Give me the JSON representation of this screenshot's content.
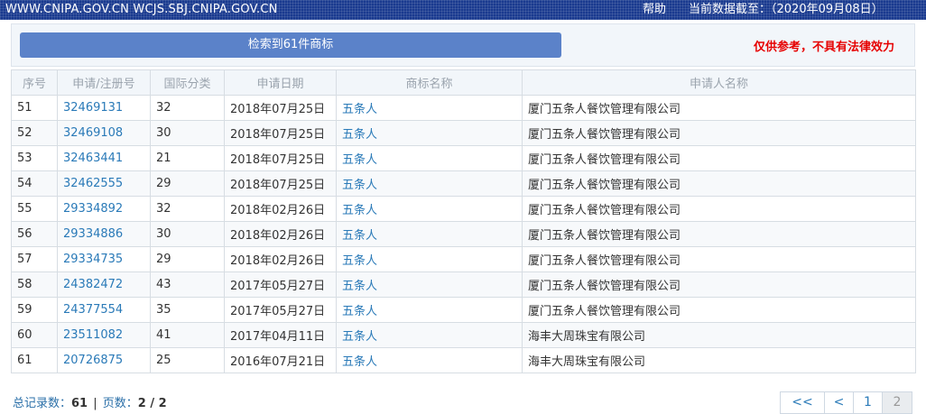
{
  "header": {
    "site": "WWW.CNIPA.GOV.CN WCJS.SBJ.CNIPA.GOV.CN",
    "help": "帮助",
    "data_as_of": "当前数据截至：（2020年09月08日）"
  },
  "result_bar": "检索到61件商标",
  "disclaimer": "仅供参考，不具有法律效力",
  "columns": [
    "序号",
    "申请/注册号",
    "国际分类",
    "申请日期",
    "商标名称",
    "申请人名称"
  ],
  "rows": [
    {
      "no": "51",
      "reg": "32469131",
      "cls": "32",
      "date": "2018年07月25日",
      "mark": "五条人",
      "applicant": "厦门五条人餐饮管理有限公司"
    },
    {
      "no": "52",
      "reg": "32469108",
      "cls": "30",
      "date": "2018年07月25日",
      "mark": "五条人",
      "applicant": "厦门五条人餐饮管理有限公司"
    },
    {
      "no": "53",
      "reg": "32463441",
      "cls": "21",
      "date": "2018年07月25日",
      "mark": "五条人",
      "applicant": "厦门五条人餐饮管理有限公司"
    },
    {
      "no": "54",
      "reg": "32462555",
      "cls": "29",
      "date": "2018年07月25日",
      "mark": "五条人",
      "applicant": "厦门五条人餐饮管理有限公司"
    },
    {
      "no": "55",
      "reg": "29334892",
      "cls": "32",
      "date": "2018年02月26日",
      "mark": "五条人",
      "applicant": "厦门五条人餐饮管理有限公司"
    },
    {
      "no": "56",
      "reg": "29334886",
      "cls": "30",
      "date": "2018年02月26日",
      "mark": "五条人",
      "applicant": "厦门五条人餐饮管理有限公司"
    },
    {
      "no": "57",
      "reg": "29334735",
      "cls": "29",
      "date": "2018年02月26日",
      "mark": "五条人",
      "applicant": "厦门五条人餐饮管理有限公司"
    },
    {
      "no": "58",
      "reg": "24382472",
      "cls": "43",
      "date": "2017年05月27日",
      "mark": "五条人",
      "applicant": "厦门五条人餐饮管理有限公司"
    },
    {
      "no": "59",
      "reg": "24377554",
      "cls": "35",
      "date": "2017年05月27日",
      "mark": "五条人",
      "applicant": "厦门五条人餐饮管理有限公司"
    },
    {
      "no": "60",
      "reg": "23511082",
      "cls": "41",
      "date": "2017年04月11日",
      "mark": "五条人",
      "applicant": "海丰大周珠宝有限公司"
    },
    {
      "no": "61",
      "reg": "20726875",
      "cls": "25",
      "date": "2016年07月21日",
      "mark": "五条人",
      "applicant": "海丰大周珠宝有限公司"
    }
  ],
  "footer": {
    "total_label": "总记录数：",
    "total_value": "61",
    "sep": "|",
    "pages_label": "页数：",
    "pages_value": "2 / 2"
  },
  "pager": {
    "first": "<<",
    "prev": "<",
    "p1": "1",
    "p2": "2"
  },
  "colors": {
    "accent": "#5b82c9",
    "topbar": "#1a3a8f",
    "link": "#2a7ab8",
    "warning": "#e60000"
  }
}
